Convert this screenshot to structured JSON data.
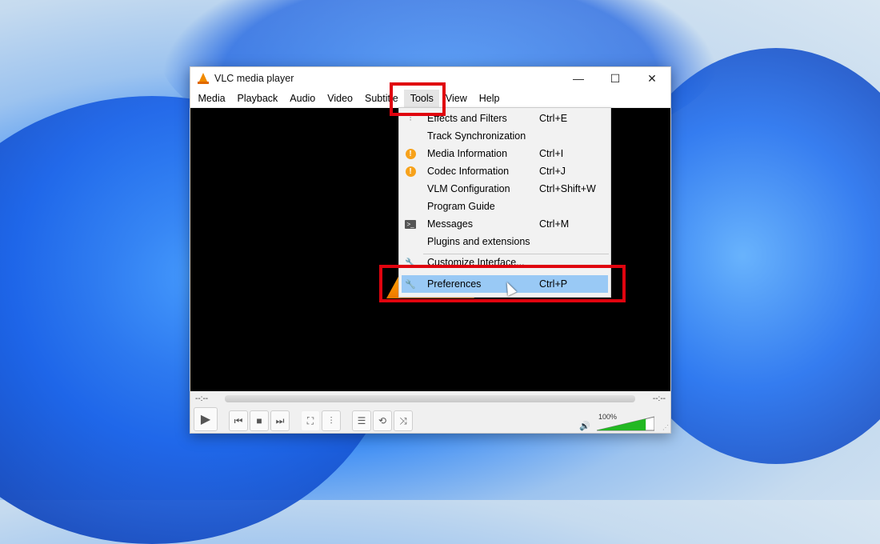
{
  "window": {
    "title": "VLC media player",
    "controls": {
      "minimize": "—",
      "maximize": "☐",
      "close": "✕"
    }
  },
  "menubar": {
    "items": [
      "Media",
      "Playback",
      "Audio",
      "Video",
      "Subtitle",
      "Tools",
      "View",
      "Help"
    ],
    "active": "Tools"
  },
  "tools_menu": {
    "items": [
      {
        "label": "Effects and Filters",
        "shortcut": "Ctrl+E",
        "icon": "equalizer-icon"
      },
      {
        "label": "Track Synchronization",
        "shortcut": "",
        "icon": ""
      },
      {
        "label": "Media Information",
        "shortcut": "Ctrl+I",
        "icon": "info-icon"
      },
      {
        "label": "Codec Information",
        "shortcut": "Ctrl+J",
        "icon": "info-icon"
      },
      {
        "label": "VLM Configuration",
        "shortcut": "Ctrl+Shift+W",
        "icon": ""
      },
      {
        "label": "Program Guide",
        "shortcut": "",
        "icon": ""
      },
      {
        "label": "Messages",
        "shortcut": "Ctrl+M",
        "icon": "terminal-icon"
      },
      {
        "label": "Plugins and extensions",
        "shortcut": "",
        "icon": ""
      },
      {
        "label": "Customize Interface...",
        "shortcut": "",
        "icon": "wrench-icon"
      },
      {
        "label": "Preferences",
        "shortcut": "Ctrl+P",
        "icon": "wrench-icon",
        "highlighted": true
      }
    ]
  },
  "player": {
    "elapsed": "--:--",
    "remaining": "--:--",
    "volume": "100%",
    "volume_level": 0.85
  },
  "colors": {
    "highlight_box": "#e0040f",
    "menu_hover": "#99c9f5",
    "vlc_orange": "#f18a00",
    "volume_green": "#22b822"
  }
}
